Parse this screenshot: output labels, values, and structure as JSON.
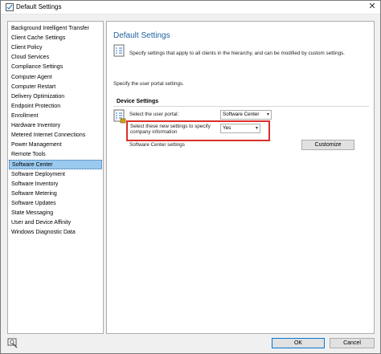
{
  "window": {
    "title": "Default Settings"
  },
  "sidebar": {
    "items": [
      {
        "label": "Background Intelligent Transfer",
        "selected": false
      },
      {
        "label": "Client Cache Settings",
        "selected": false
      },
      {
        "label": "Client Policy",
        "selected": false
      },
      {
        "label": "Cloud Services",
        "selected": false
      },
      {
        "label": "Compliance Settings",
        "selected": false
      },
      {
        "label": "Computer Agent",
        "selected": false
      },
      {
        "label": "Computer Restart",
        "selected": false
      },
      {
        "label": "Delivery Optimization",
        "selected": false
      },
      {
        "label": "Endpoint Protection",
        "selected": false
      },
      {
        "label": "Enrollment",
        "selected": false
      },
      {
        "label": "Hardware Inventory",
        "selected": false
      },
      {
        "label": "Metered Internet Connections",
        "selected": false
      },
      {
        "label": "Power Management",
        "selected": false
      },
      {
        "label": "Remote Tools",
        "selected": false
      },
      {
        "label": "Software Center",
        "selected": true
      },
      {
        "label": "Software Deployment",
        "selected": false
      },
      {
        "label": "Software Inventory",
        "selected": false
      },
      {
        "label": "Software Metering",
        "selected": false
      },
      {
        "label": "Software Updates",
        "selected": false
      },
      {
        "label": "State Messaging",
        "selected": false
      },
      {
        "label": "User and Device Affinity",
        "selected": false
      },
      {
        "label": "Windows Diagnostic Data",
        "selected": false
      }
    ]
  },
  "main": {
    "title": "Default Settings",
    "intro": "Specify settings that apply to all clients in the hierarchy, and can be modified by custom settings.",
    "portal_text": "Specify the user portal settings.",
    "section_title": "Device Settings",
    "portal_label": "Select the user portal:",
    "portal_value": "Software Center",
    "company_label": "Select these new settings to specify company information",
    "company_value": "Yes",
    "sc_settings_label": "Software Center settings",
    "customize_label": "Customize"
  },
  "footer": {
    "ok_label": "OK",
    "cancel_label": "Cancel"
  },
  "colors": {
    "title_blue": "#1f5f9e",
    "selection": "#99c9ef",
    "highlight_red": "#d9302c"
  },
  "icons": [
    "settings-window-icon",
    "close-icon",
    "settings-doc-icon",
    "settings-list-icon",
    "chevron-down-icon",
    "status-icon"
  ]
}
